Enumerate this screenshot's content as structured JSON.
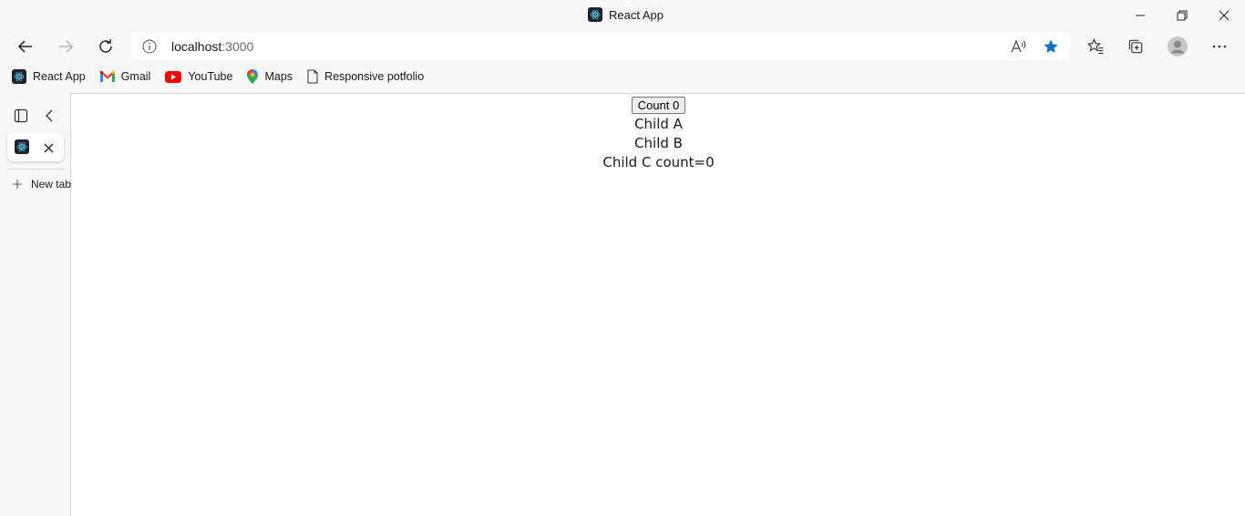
{
  "window": {
    "title": "React App"
  },
  "address": {
    "host": "localhost",
    "port": ":3000"
  },
  "bookmarks": [
    {
      "label": "React App",
      "icon": "react-icon"
    },
    {
      "label": "Gmail",
      "icon": "gmail-icon"
    },
    {
      "label": "YouTube",
      "icon": "youtube-icon"
    },
    {
      "label": "Maps",
      "icon": "maps-icon"
    },
    {
      "label": "Responsive potfolio",
      "icon": "document-icon"
    }
  ],
  "sidebar": {
    "new_tab_label": "New tab"
  },
  "app": {
    "count_button": "Count 0",
    "child_a": "Child A",
    "child_b": "Child B",
    "child_c": "Child C count=0"
  },
  "colors": {
    "accent": "#0f6cbd",
    "background": "#f7f7f7",
    "page": "#ffffff"
  }
}
